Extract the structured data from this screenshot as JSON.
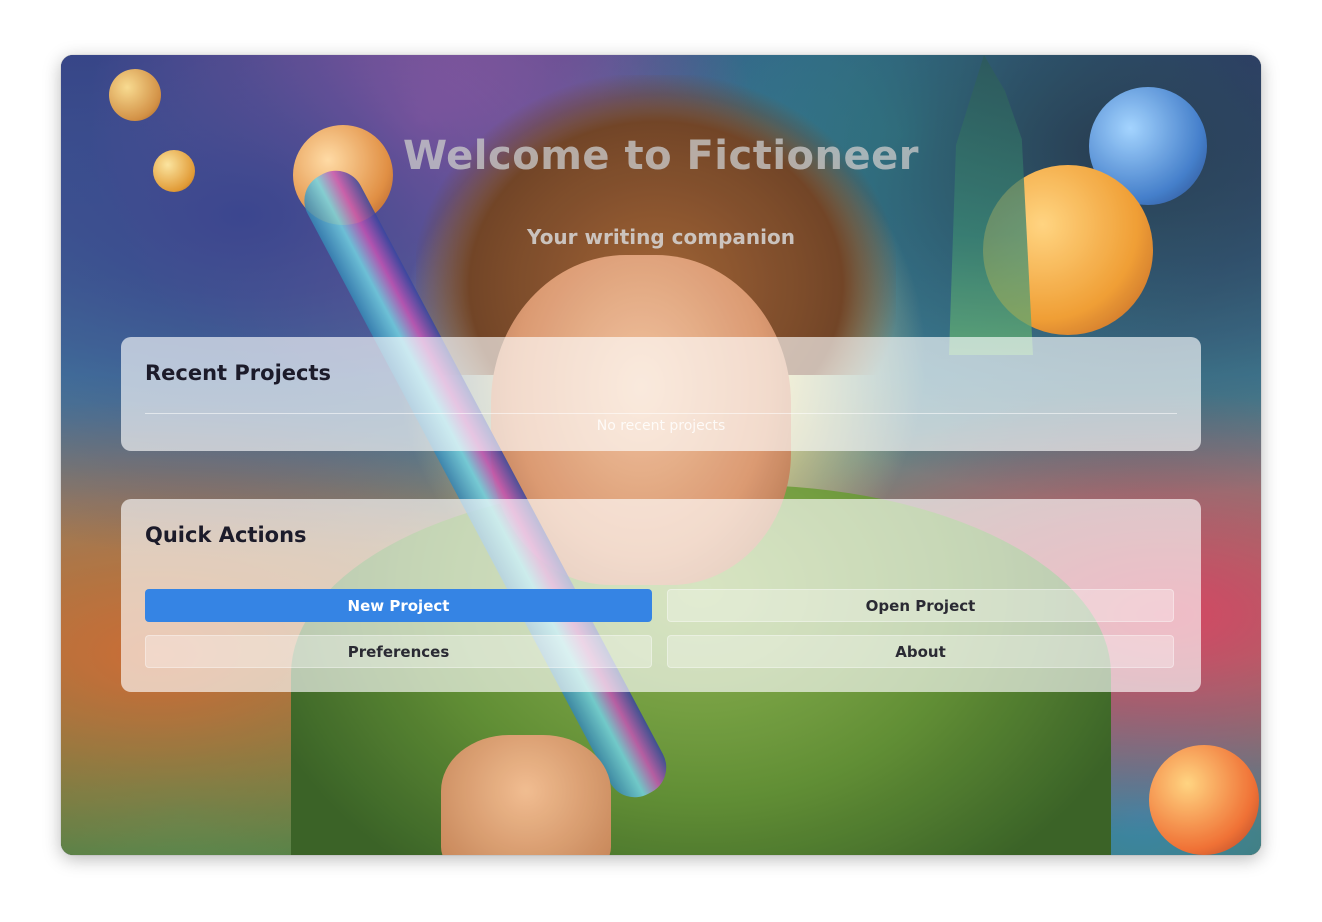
{
  "app": {
    "title": "Welcome to Fictioneer",
    "subtitle": "Your writing companion"
  },
  "recent_projects": {
    "heading": "Recent Projects",
    "empty_message": "No recent projects",
    "items": []
  },
  "quick_actions": {
    "heading": "Quick Actions",
    "buttons": {
      "new_project": "New Project",
      "open_project": "Open Project",
      "preferences": "Preferences",
      "about": "About"
    }
  },
  "colors": {
    "accent": "#3584e4",
    "heading_text": "#1c1b2a",
    "panel_background": "rgba(255,255,255,0.64)"
  },
  "background_image": "illustrated hero with fedora-wearing man holding a fountain pen among planets"
}
